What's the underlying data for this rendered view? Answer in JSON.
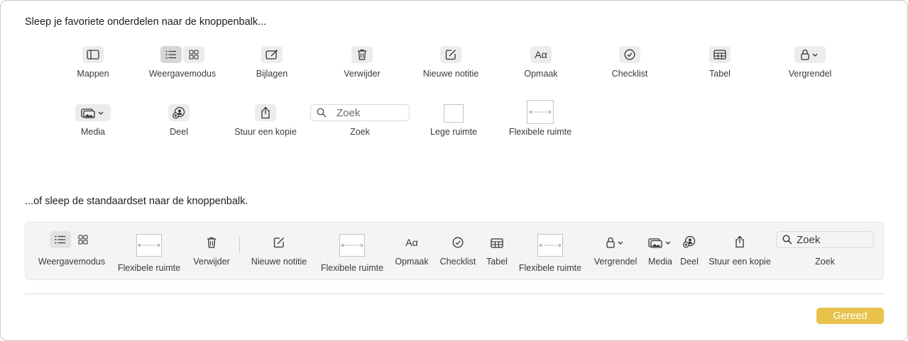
{
  "instructions": {
    "favorites": "Sleep je favoriete onderdelen naar de knoppenbalk...",
    "default_set": "...of sleep de standaardset naar de knoppenbalk."
  },
  "palette": [
    {
      "label": "Mappen",
      "icon": "sidebar-icon"
    },
    {
      "label": "Weergavemodus",
      "icon": "view-mode-icon"
    },
    {
      "label": "Bijlagen",
      "icon": "attachments-icon"
    },
    {
      "label": "Verwijder",
      "icon": "trash-icon"
    },
    {
      "label": "Nieuwe notitie",
      "icon": "compose-icon"
    },
    {
      "label": "Opmaak",
      "icon": "format-icon"
    },
    {
      "label": "Checklist",
      "icon": "checklist-icon"
    },
    {
      "label": "Tabel",
      "icon": "table-icon"
    },
    {
      "label": "Vergrendel",
      "icon": "lock-icon"
    },
    {
      "label": "Media",
      "icon": "media-icon"
    },
    {
      "label": "Deel",
      "icon": "share-icon"
    },
    {
      "label": "Stuur een kopie",
      "icon": "send-copy-icon"
    },
    {
      "label": "Zoek",
      "icon": "search-icon"
    },
    {
      "label": "Lege ruimte",
      "icon": "space-icon"
    },
    {
      "label": "Flexibele ruimte",
      "icon": "flexible-space-icon"
    }
  ],
  "format_glyph": "Aα",
  "search_placeholder": "Zoek",
  "default_set": [
    {
      "label": "Weergavemodus"
    },
    {
      "label": "Flexibele ruimte"
    },
    {
      "label": "Verwijder"
    },
    {
      "label": "Nieuwe notitie"
    },
    {
      "label": "Flexibele ruimte"
    },
    {
      "label": "Opmaak"
    },
    {
      "label": "Checklist"
    },
    {
      "label": "Tabel"
    },
    {
      "label": "Flexibele ruimte"
    },
    {
      "label": "Vergrendel"
    },
    {
      "label": "Media"
    },
    {
      "label": "Deel"
    },
    {
      "label": "Stuur een kopie"
    },
    {
      "label": "Zoek"
    }
  ],
  "done_button": "Gereed",
  "colors": {
    "accent": "#e8c24a"
  }
}
